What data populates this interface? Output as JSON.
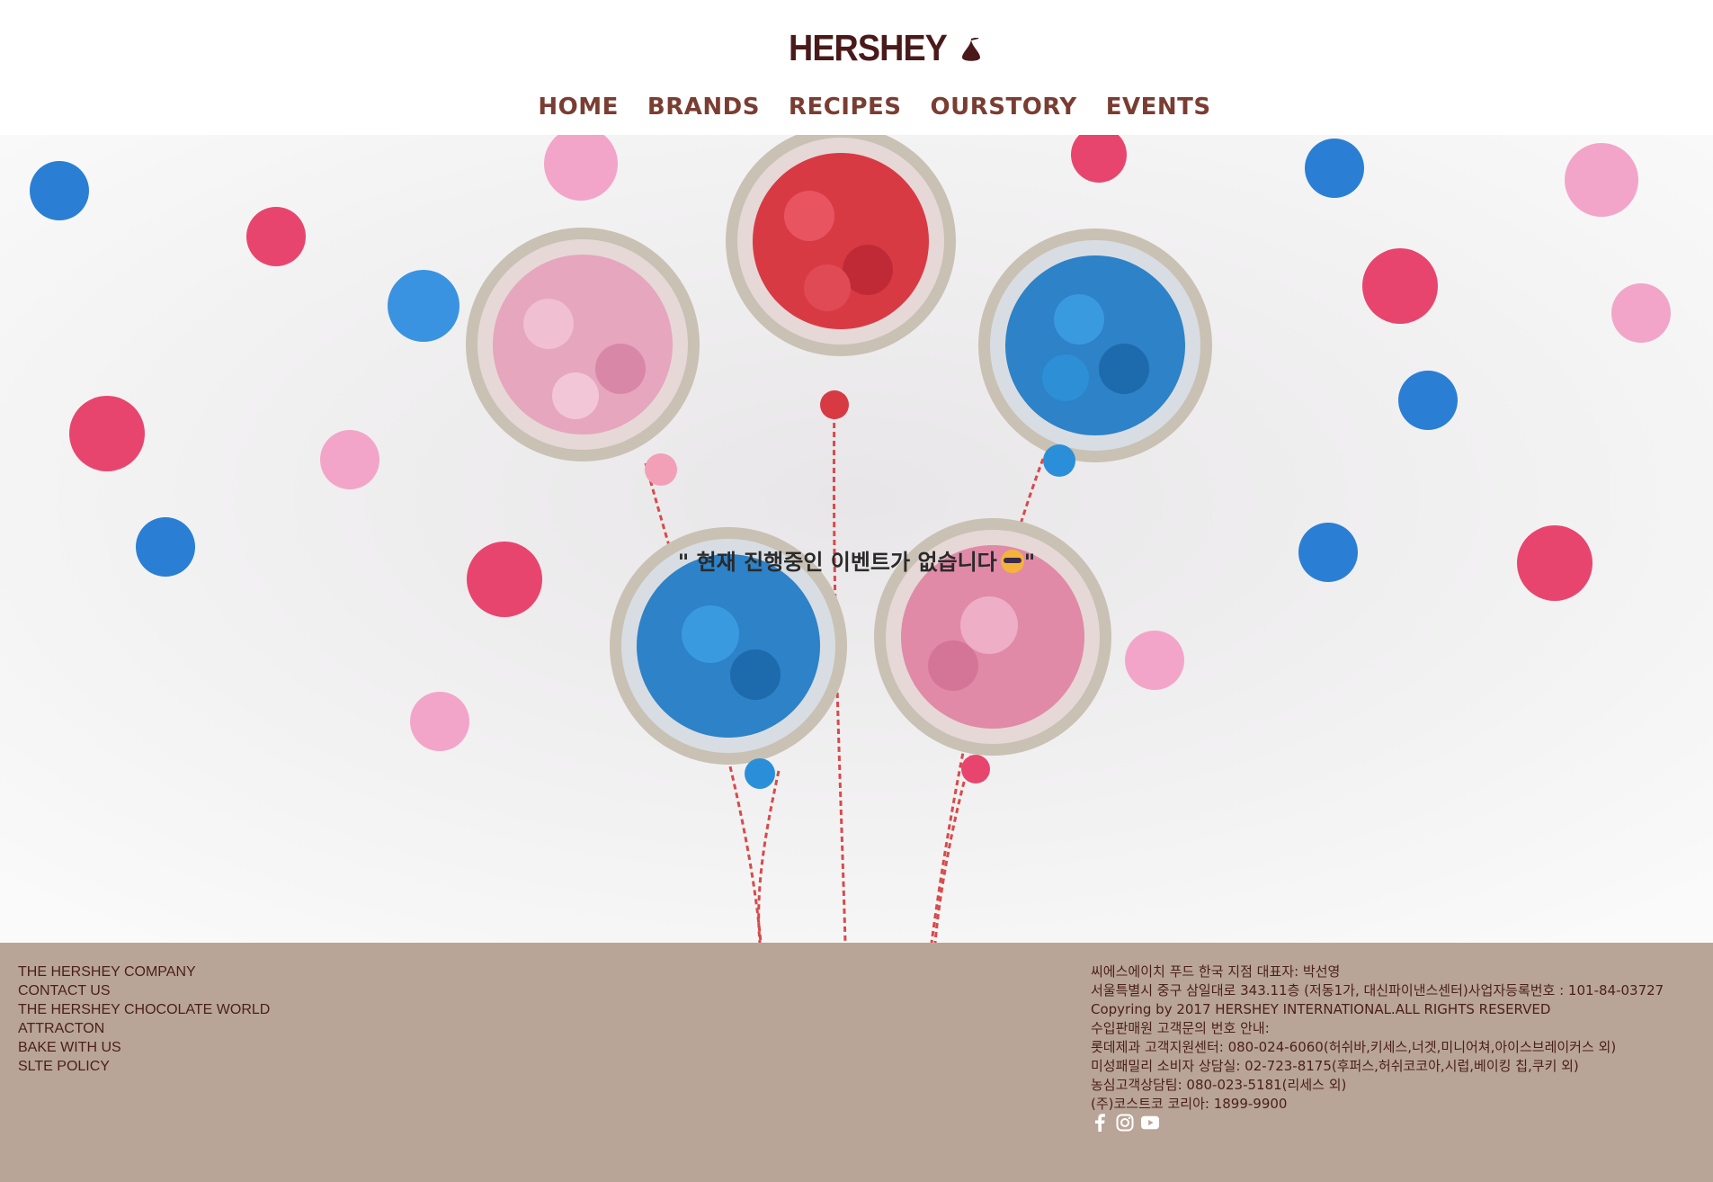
{
  "header": {
    "logo_text": "HERSHEY",
    "nav": [
      "HOME",
      "BRANDS",
      "RECIPES",
      "OURSTORY",
      "EVENTS"
    ]
  },
  "hero": {
    "message": "\" 현재 진행중인 이벤트가 없습니다",
    "message_end": "\"",
    "emoji": "cool-face-emoji"
  },
  "footer": {
    "links": [
      "THE HERSHEY COMPANY",
      "CONTACT US",
      "THE HERSHEY CHOCOLATE WORLD",
      "ATTRACTON",
      "BAKE WITH US",
      "SLTE POLICY"
    ],
    "info": [
      "씨에스에이치 푸드 한국 지점 대표자: 박선영",
      "서울특별시 중구 삼일대로 343.11층 (저동1가, 대신파이낸스센터)사업자등록번호 : 101-84-03727",
      "Copyring by 2017 HERSHEY INTERNATIONAL.ALL RIGHTS RESERVED",
      "수입판매원 고객문의 번호 안내:",
      "롯데제과 고객지원센터: 080-024-6060(허쉬바,키세스,너겟,미니어쳐,아이스브레이커스 외)",
      "미성패밀리 소비자 상담실: 02-723-8175(후퍼스,허쉬코코아,시럽,베이킹 칩,쿠키 외)",
      "농심고객상담팀: 080-023-5181(리세스 외)",
      "(주)코스트코 코리아: 1899-9900"
    ],
    "social": [
      "facebook-icon",
      "instagram-icon",
      "youtube-icon"
    ]
  },
  "colors": {
    "nav_text": "#7a3d32",
    "footer_bg": "#b9a598",
    "footer_text": "#4a1f1a",
    "logo": "#4a1a1a"
  }
}
